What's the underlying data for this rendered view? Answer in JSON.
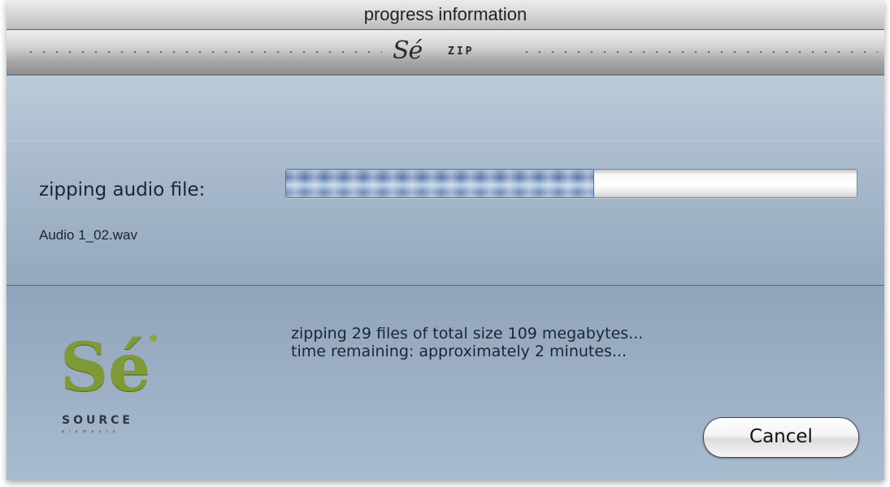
{
  "window": {
    "title": "progress information"
  },
  "brand_bar": {
    "logo_text": "Sé",
    "app_name": "ZIP"
  },
  "task": {
    "label": "zipping audio file:",
    "current_file": "Audio 1_02.wav",
    "progress_fraction": 0.54
  },
  "status": {
    "line1": "zipping 29 files of total size 109 megabytes...",
    "line2": "time remaining: approximately 2 minutes..."
  },
  "logo": {
    "mark": "Sé",
    "word1": "SOURCE",
    "word2": "elements"
  },
  "buttons": {
    "cancel_label": "Cancel"
  },
  "colors": {
    "accent_progress": "#5b79a6",
    "logo_green": "#7f9a35",
    "panel_blue": "#a8b9cc"
  }
}
